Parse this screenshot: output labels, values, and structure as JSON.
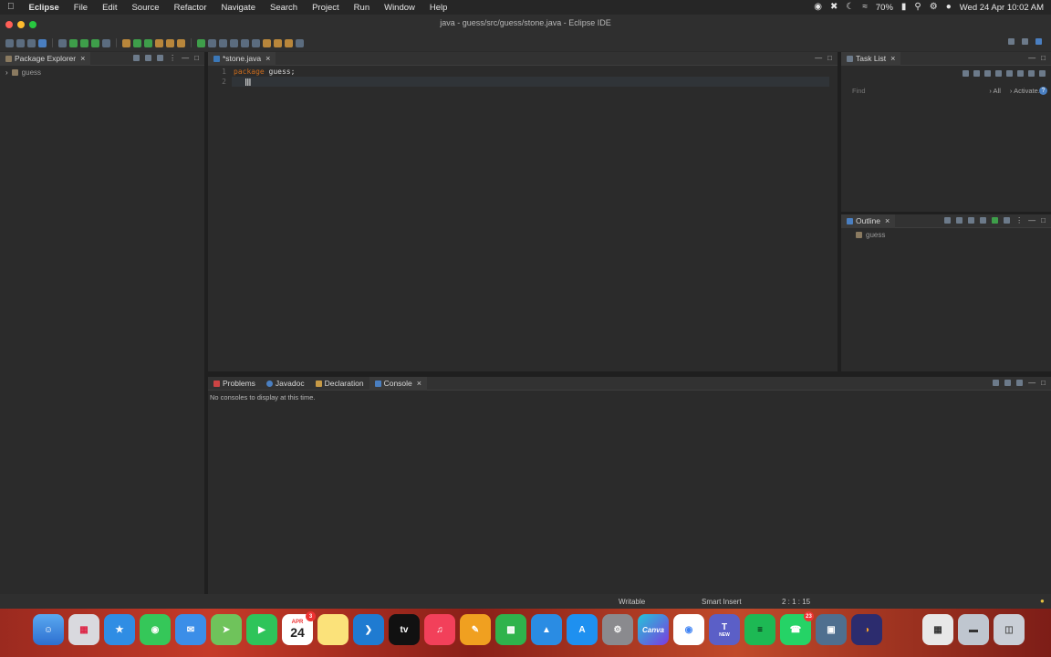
{
  "menubar": {
    "app": "Eclipse",
    "items": [
      "File",
      "Edit",
      "Source",
      "Refactor",
      "Navigate",
      "Search",
      "Project",
      "Run",
      "Window",
      "Help"
    ],
    "battery": "70%",
    "clock": "Wed 24 Apr  10:02 AM"
  },
  "window": {
    "title": "java - guess/src/guess/stone.java - Eclipse IDE"
  },
  "package_explorer": {
    "tab": "Package Explorer",
    "tree": [
      "guess"
    ]
  },
  "editor": {
    "tab": "*stone.java",
    "lines": [
      {
        "num": "1",
        "keyword": "package",
        "text": " guess;"
      },
      {
        "num": "2",
        "keyword": "",
        "text": ""
      }
    ]
  },
  "task_list": {
    "tab": "Task List",
    "find_placeholder": "Find",
    "all_label": "All",
    "activate_label": "Activate..."
  },
  "outline": {
    "tab": "Outline",
    "items": [
      "guess"
    ]
  },
  "bottom_panel": {
    "tabs": [
      "Problems",
      "Javadoc",
      "Declaration",
      "Console"
    ],
    "active_tab": "Console",
    "message": "No consoles to display at this time."
  },
  "status_bar": {
    "writable": "Writable",
    "insert_mode": "Smart Insert",
    "position": "2 : 1 : 15"
  },
  "dock": {
    "calendar_month": "APR",
    "calendar_day": "24",
    "calendar_badge": "3",
    "whatsapp_badge": "23",
    "canva_label": "Canva",
    "teams_label": "NEW"
  },
  "colors": {
    "keyword": "#cc6c1d",
    "dock_base": "#b3321f"
  }
}
